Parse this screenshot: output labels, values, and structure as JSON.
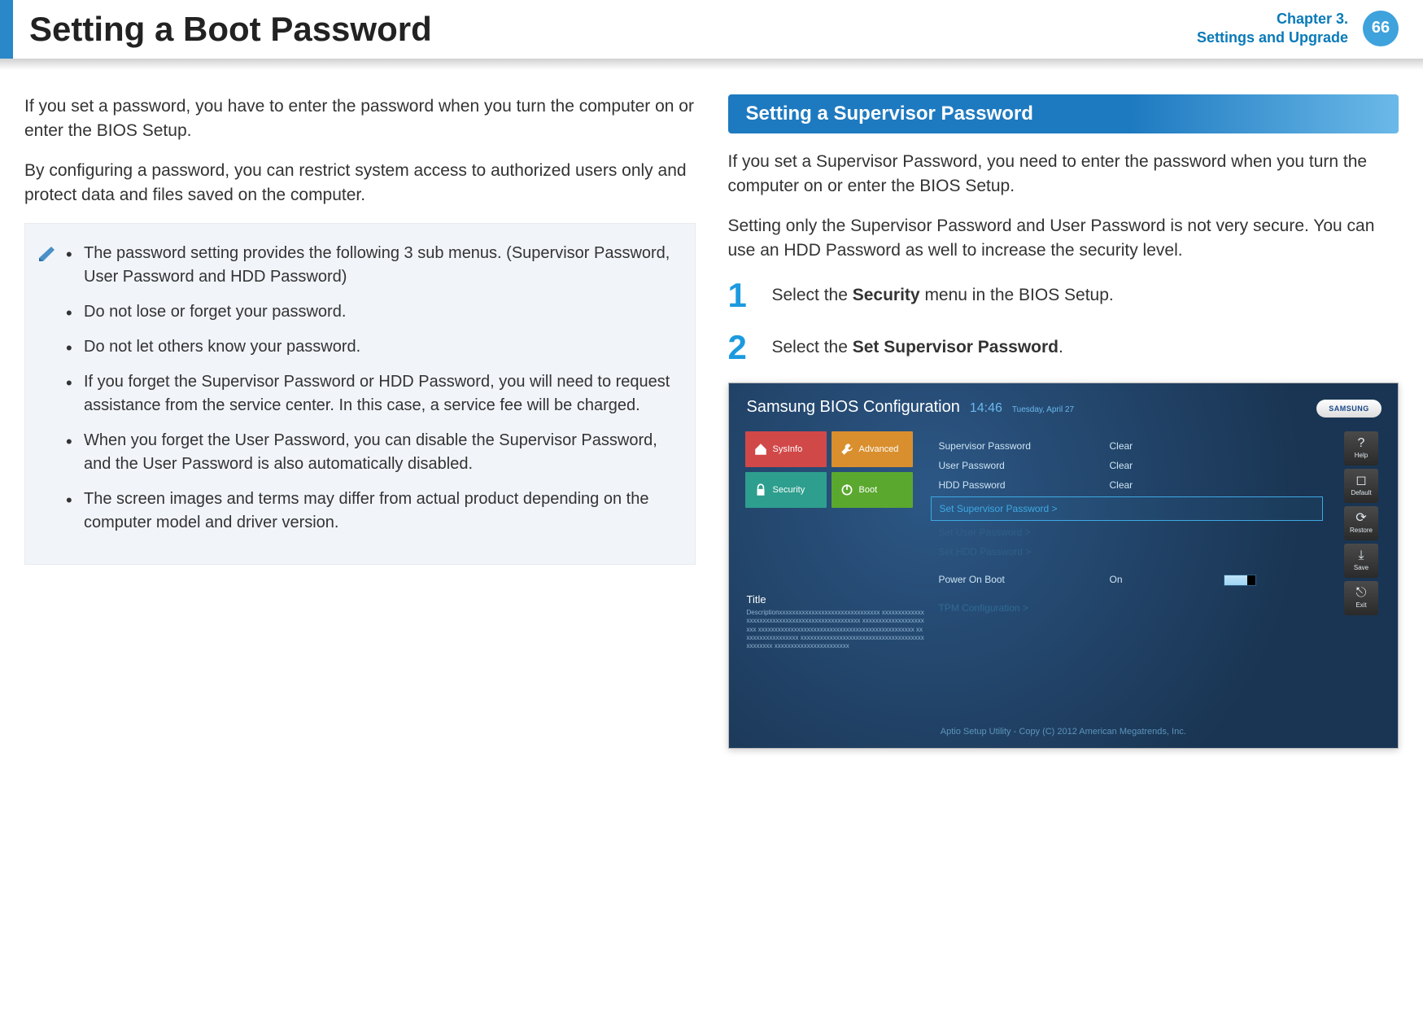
{
  "header": {
    "title": "Setting a Boot Password",
    "chapter_line1": "Chapter 3.",
    "chapter_line2": "Settings and Upgrade",
    "page_number": "66"
  },
  "left": {
    "p1": "If you set a password, you have to enter the password when you turn the computer on or enter the BIOS Setup.",
    "p2": "By configuring a password, you can restrict system access to authorized users only and protect data and files saved on the computer.",
    "notes": [
      "The password setting provides the following 3 sub menus. (Supervisor Password, User Password and HDD Password)",
      "Do not lose or forget your password.",
      "Do not let others know your password.",
      "If you forget the Supervisor Password or HDD Password, you will need to request assistance from the service center. In this case, a service fee will be charged.",
      "When you forget the User Password, you can disable the Supervisor Password, and the User Password is also automatically disabled.",
      "The screen images and terms may differ from actual product depending on the computer model and driver version."
    ]
  },
  "right": {
    "section_title": "Setting a Supervisor Password",
    "p1": "If you set a Supervisor Password, you need to enter the password when you turn the computer on or enter the BIOS Setup.",
    "p2": "Setting only the Supervisor Password and User Password is not very secure. You can use an HDD Password as well to increase the security level.",
    "step1_pre": "Select the ",
    "step1_bold": "Security",
    "step1_post": " menu in the BIOS Setup.",
    "step2_pre": "Select the ",
    "step2_bold": "Set Supervisor Password",
    "step2_post": "."
  },
  "bios": {
    "title": "Samsung BIOS Configuration",
    "time": "14:46",
    "date": "Tuesday, April 27",
    "logo": "SAMSUNG",
    "nav": {
      "sysinfo": "SysInfo",
      "advanced": "Advanced",
      "security": "Security",
      "boot": "Boot"
    },
    "rows": {
      "sup_k": "Supervisor Password",
      "sup_v": "Clear",
      "usr_k": "User Password",
      "usr_v": "Clear",
      "hdd_k": "HDD Password",
      "hdd_v": "Clear",
      "set_sup": "Set Supervisor Password >",
      "set_usr": "Set User Password >",
      "set_hdd": "Set HDD Password >",
      "pob_k": "Power On Boot",
      "pob_v": "On",
      "tpm": "TPM Configuration >"
    },
    "info": {
      "title": "Title",
      "desc": "Descriptionxxxxxxxxxxxxxxxxxxxxxxxxxxxxxxx xxxxxxxxxxxxxxxxxxxxxxxxxxxxxxxxxxxxxxxxxxxxxxxx xxxxxxxxxxxxxxxxxxxxxx xxxxxxxxxxxxxxxxxxxxxxxxxxxxxxxxxxxxxxxxxxxxxxxx xxxxxxxxxxxxxxxxxx xxxxxxxxxxxxxxxxxxxxxxxxxxxxxxxxxxxxxxxxxxxxxx xxxxxxxxxxxxxxxxxxxxxxx"
    },
    "sidebar": {
      "help": "Help",
      "default": "Default",
      "restore": "Restore",
      "save": "Save",
      "exit": "Exit"
    },
    "footer": "Aptio Setup Utility - Copy (C) 2012 American Megatrends, Inc."
  }
}
